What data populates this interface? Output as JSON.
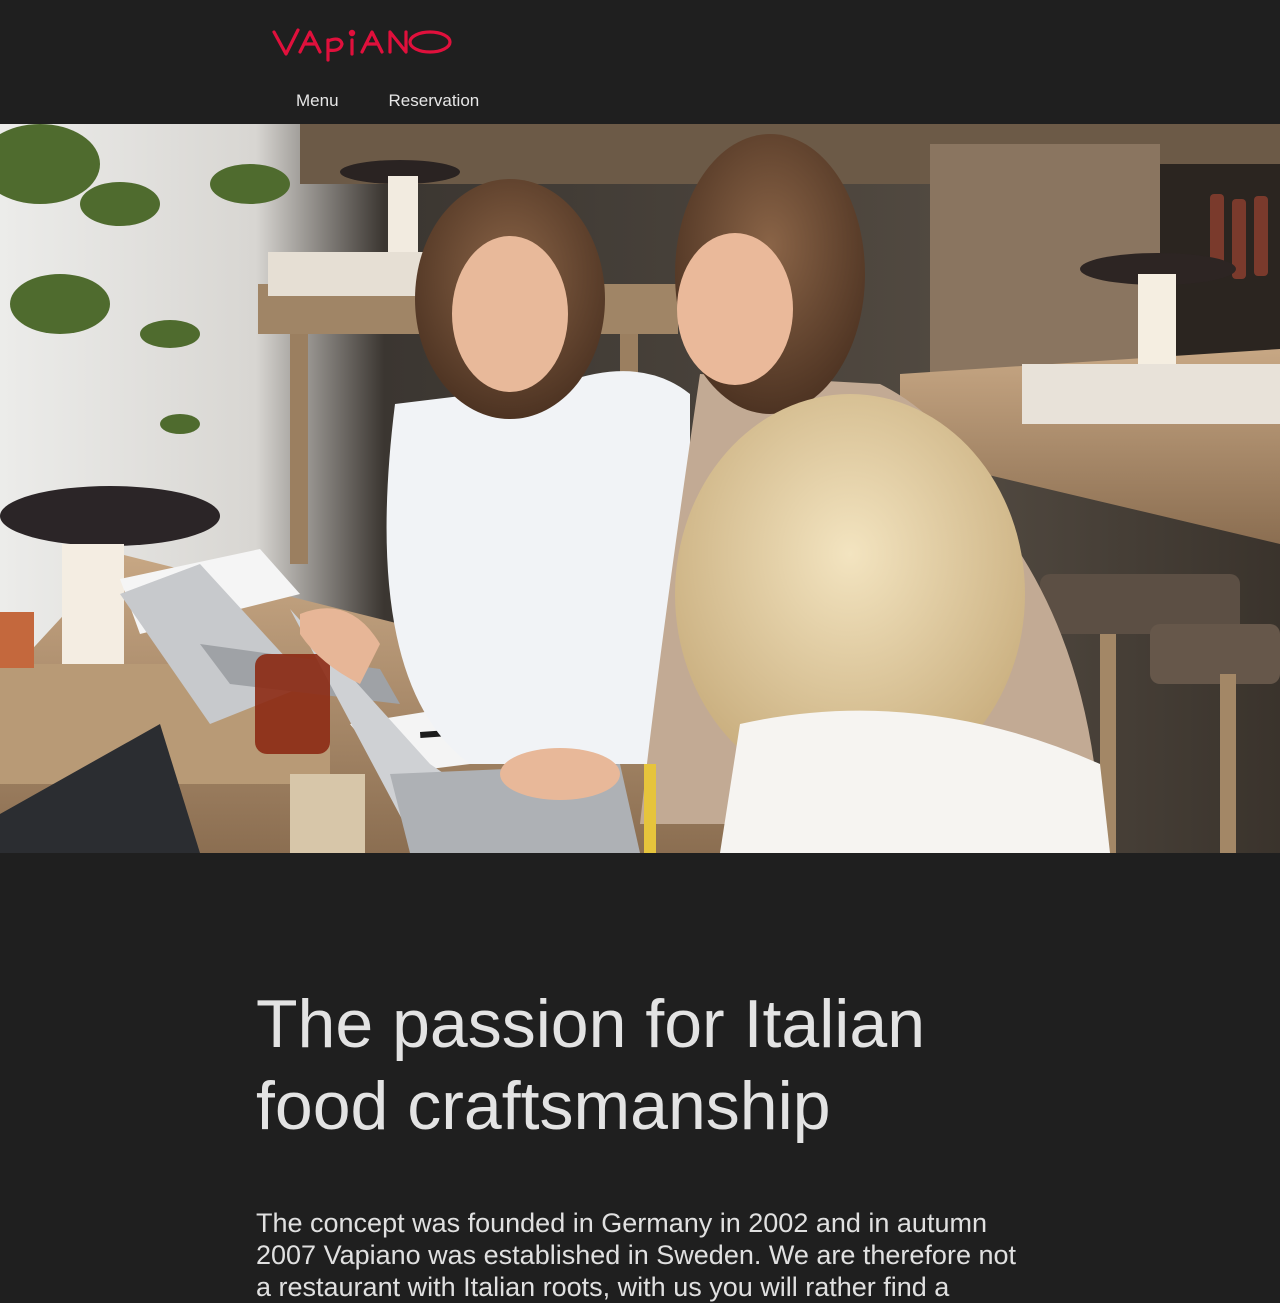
{
  "brand": {
    "logo_text": "VAPIANO",
    "color": "#e0103c"
  },
  "nav": {
    "items": [
      "Menu",
      "Reservation"
    ]
  },
  "hero": {
    "image_alt": "Three women working on laptops at a table in a Vapiano restaurant"
  },
  "main": {
    "heading": "The passion for Italian food craftsmanship",
    "intro": "The concept was founded in Germany in 2002 and in autumn 2007 Vapiano was established in Sweden. We are therefore not a restaurant with Italian roots, with us you will rather find a"
  },
  "colors": {
    "background": "#1f1f1f",
    "text": "#e6e6e6"
  }
}
